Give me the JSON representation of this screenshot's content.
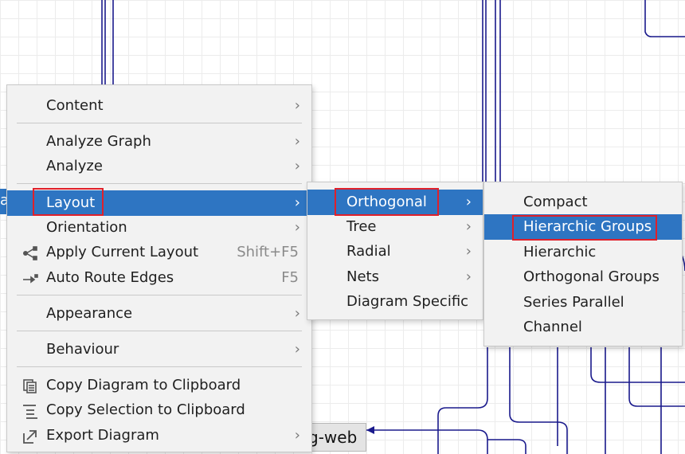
{
  "canvas": {
    "node_label": "g-web",
    "left_stub_label": "a"
  },
  "main_menu": {
    "items": [
      {
        "label": "Content",
        "submenu": true
      },
      {
        "label": "Analyze Graph",
        "submenu": true
      },
      {
        "label": "Analyze",
        "submenu": true
      },
      {
        "label": "Layout",
        "submenu": true,
        "highlighted": true
      },
      {
        "label": "Orientation",
        "submenu": true
      },
      {
        "label": "Apply Current Layout",
        "shortcut": "Shift+F5",
        "icon": "layout-tree-icon"
      },
      {
        "label": "Auto Route Edges",
        "shortcut": "F5",
        "icon": "route-edges-icon"
      },
      {
        "label": "Appearance",
        "submenu": true
      },
      {
        "label": "Behaviour",
        "submenu": true
      },
      {
        "label": "Copy Diagram to Clipboard",
        "icon": "copy-icon"
      },
      {
        "label": "Copy Selection to Clipboard",
        "icon": "copy-selection-icon"
      },
      {
        "label": "Export Diagram",
        "submenu": true,
        "icon": "export-icon"
      }
    ]
  },
  "layout_submenu": {
    "items": [
      {
        "label": "Orthogonal",
        "submenu": true,
        "highlighted": true
      },
      {
        "label": "Tree",
        "submenu": true
      },
      {
        "label": "Radial",
        "submenu": true
      },
      {
        "label": "Nets",
        "submenu": true
      },
      {
        "label": "Diagram Specific"
      }
    ]
  },
  "orthogonal_submenu": {
    "items": [
      {
        "label": "Compact"
      },
      {
        "label": "Hierarchic Groups",
        "highlighted": true
      },
      {
        "label": "Hierarchic"
      },
      {
        "label": "Orthogonal Groups"
      },
      {
        "label": "Series Parallel"
      },
      {
        "label": "Channel"
      }
    ]
  },
  "colors": {
    "highlight": "#2e75c2",
    "annotation": "#e0202a",
    "wire": "#1a1a8c"
  }
}
